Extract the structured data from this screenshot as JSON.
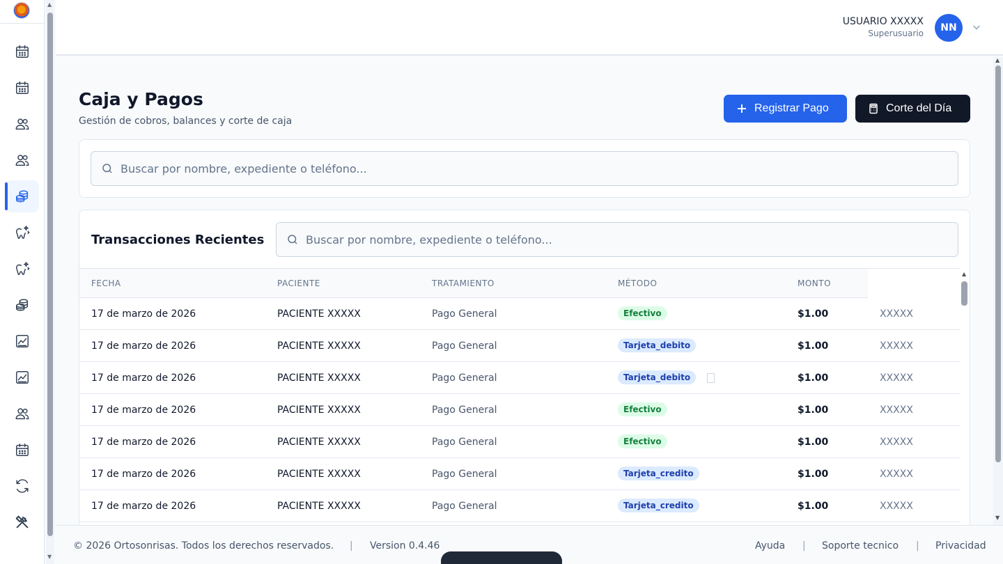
{
  "header": {
    "user_name": "USUARIO XXXXX",
    "user_role": "Superusuario",
    "avatar_initials": "NN"
  },
  "sidebar": {
    "items": [
      {
        "icon": "calendar-icon"
      },
      {
        "icon": "calendar-icon"
      },
      {
        "icon": "users-icon"
      },
      {
        "icon": "users-icon"
      },
      {
        "icon": "coins-icon",
        "active": true
      },
      {
        "icon": "tooth-sparkle-icon"
      },
      {
        "icon": "tooth-sparkle-icon"
      },
      {
        "icon": "coins-icon"
      },
      {
        "icon": "chart-icon"
      },
      {
        "icon": "chart-icon"
      },
      {
        "icon": "users-icon"
      },
      {
        "icon": "calendar-icon"
      },
      {
        "icon": "refresh-icon"
      },
      {
        "icon": "tools-icon"
      }
    ]
  },
  "page": {
    "title": "Caja y Pagos",
    "subtitle": "Gestión de cobros, balances y corte de caja",
    "register_button": "Registrar Pago",
    "cut_button": "Corte del Día"
  },
  "search": {
    "placeholder": "Buscar por nombre, expediente o teléfono..."
  },
  "transactions": {
    "title": "Transacciones Recientes",
    "search_placeholder": "Buscar por nombre, expediente o teléfono...",
    "columns": [
      "FECHA",
      "PACIENTE",
      "TRATAMIENTO",
      "MÉTODO",
      "MONTO"
    ],
    "rows": [
      {
        "fecha": "17 de marzo de 2026",
        "paciente": "PACIENTE XXXXX",
        "tratamiento": "Pago General",
        "metodo": "Efectivo",
        "monto": "$1.00",
        "extra": "XXXXX"
      },
      {
        "fecha": "17 de marzo de 2026",
        "paciente": "PACIENTE XXXXX",
        "tratamiento": "Pago General",
        "metodo": "Tarjeta_debito",
        "monto": "$1.00",
        "extra": "XXXXX"
      },
      {
        "fecha": "17 de marzo de 2026",
        "paciente": "PACIENTE XXXXX",
        "tratamiento": "Pago General",
        "metodo": "Tarjeta_debito",
        "monto": "$1.00",
        "extra": "XXXXX"
      },
      {
        "fecha": "17 de marzo de 2026",
        "paciente": "PACIENTE XXXXX",
        "tratamiento": "Pago General",
        "metodo": "Efectivo",
        "monto": "$1.00",
        "extra": "XXXXX"
      },
      {
        "fecha": "17 de marzo de 2026",
        "paciente": "PACIENTE XXXXX",
        "tratamiento": "Pago General",
        "metodo": "Efectivo",
        "monto": "$1.00",
        "extra": "XXXXX"
      },
      {
        "fecha": "17 de marzo de 2026",
        "paciente": "PACIENTE XXXXX",
        "tratamiento": "Pago General",
        "metodo": "Tarjeta_credito",
        "monto": "$1.00",
        "extra": "XXXXX"
      },
      {
        "fecha": "17 de marzo de 2026",
        "paciente": "PACIENTE XXXXX",
        "tratamiento": "Pago General",
        "metodo": "Tarjeta_credito",
        "monto": "$1.00",
        "extra": "XXXXX"
      }
    ]
  },
  "footer": {
    "copyright": "© 2026 Ortosonrisas. Todos los derechos reservados.",
    "separator": "|",
    "version": "Version 0.4.46",
    "links": [
      "Ayuda",
      "Soporte tecnico",
      "Privacidad"
    ]
  },
  "colors": {
    "accent": "#2563eb",
    "dark_button": "#111827",
    "badge_cash_bg": "#dcfce7",
    "badge_cash_fg": "#15803d",
    "badge_card_bg": "#dbeafe",
    "badge_card_fg": "#1e40af"
  }
}
